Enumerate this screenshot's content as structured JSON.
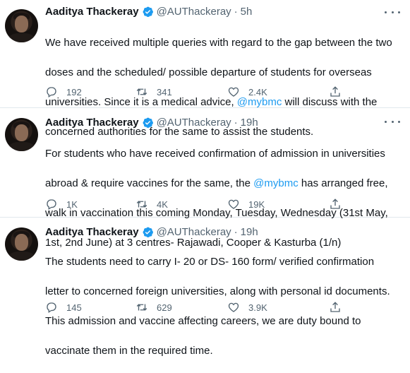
{
  "tweets": [
    {
      "author": "Aaditya Thackeray",
      "handle": "@AUThackeray",
      "separator": "·",
      "time": "5h",
      "text_lines": [
        "We have received multiple queries with regard to the gap between the two",
        "doses and the scheduled/ possible departure of students for overseas",
        [
          "universities. Since it is a medical advice, ",
          "@mybmc",
          " will discuss with the"
        ],
        "concerned authorities for the same to assist the students."
      ],
      "replies": "192",
      "retweets": "341",
      "likes": "2.4K"
    },
    {
      "author": "Aaditya Thackeray",
      "handle": "@AUThackeray",
      "separator": "·",
      "time": "19h",
      "text_lines": [
        "For students who have received confirmation of admission in universities",
        [
          "abroad & require vaccines for the same, the ",
          "@mybmc",
          " has arranged free,"
        ],
        "walk in vaccination this coming Monday, Tuesday, Wednesday (31st May,",
        "1st, 2nd June) at 3 centres- Rajawadi, Cooper & Kasturba (1/n)"
      ],
      "replies": "1K",
      "retweets": "4K",
      "likes": "19K"
    },
    {
      "author": "Aaditya Thackeray",
      "handle": "@AUThackeray",
      "separator": "·",
      "time": "19h",
      "text_lines": [
        "The students need to carry I- 20 or DS- 160 form/ verified confirmation",
        "letter to concerned foreign universities, along with personal id documents.",
        "This admission and vaccine affecting careers, we are duty bound to",
        "vaccinate them in the required time."
      ],
      "replies": "145",
      "retweets": "629",
      "likes": "3.9K"
    }
  ],
  "colors": {
    "text": "#0f1419",
    "muted": "#536471",
    "accent": "#1d9bf0",
    "divider": "#e1e8ed"
  },
  "icons": [
    "verified-badge-icon",
    "more-icon",
    "reply-icon",
    "retweet-icon",
    "like-icon",
    "share-icon"
  ]
}
